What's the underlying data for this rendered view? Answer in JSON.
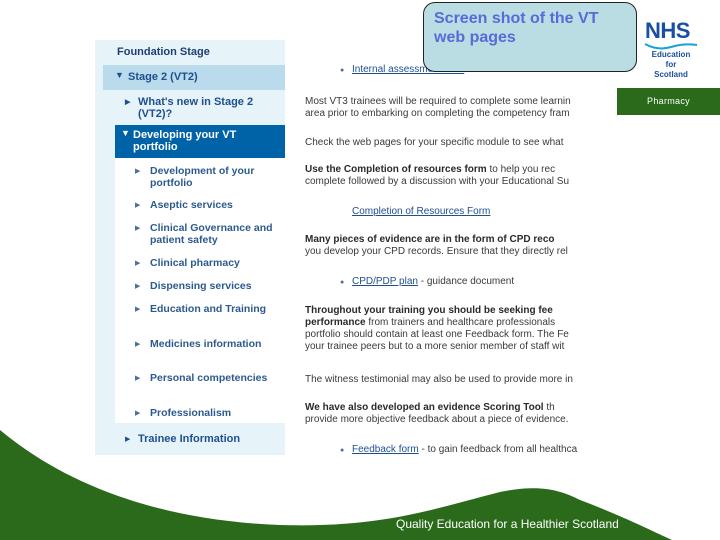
{
  "callout": {
    "text": "Screen shot of the VT web pages"
  },
  "logo": {
    "brand": "NHS",
    "subtitle_lines": [
      "Education",
      "for",
      "Scotland"
    ]
  },
  "section_badge": {
    "label": "Pharmacy"
  },
  "footer": {
    "tagline": "Quality Education for a Healthier Scotland"
  },
  "colors": {
    "brand_green": "#2a6a1a",
    "nav_active": "#0063a8",
    "nav_bg": "#e6f4fa",
    "nav_stage": "#b9dbec",
    "callout_bg": "#b9dde3",
    "callout_text": "#5a6ad9",
    "nhs_blue": "#1a4e9f"
  },
  "sidebar": {
    "top_item": "Foundation Stage",
    "stage": {
      "label": "Stage 2 (VT2)"
    },
    "whats_new": {
      "label": "What's new in Stage 2 (VT2)?"
    },
    "active": {
      "label": "Developing your VT portfolio"
    },
    "sub_items": [
      {
        "label": "Development of your portfolio"
      },
      {
        "label": "Aseptic services"
      },
      {
        "label": "Clinical Governance and patient safety"
      },
      {
        "label": "Clinical pharmacy"
      },
      {
        "label": "Dispensing services"
      },
      {
        "label": "Education and Training"
      },
      {
        "label": "Medicines information"
      },
      {
        "label": "Personal competencies"
      },
      {
        "label": "Professionalism"
      }
    ],
    "trainee": {
      "label": "Trainee Information"
    }
  },
  "main": {
    "top_link": "Internal assessment form",
    "para1_line1": "Most VT3 trainees will be required to complete some learnin",
    "para1_line2": "area prior to embarking on completing the competency fram",
    "para2": "Check the web pages for your specific module to see what",
    "para3_bold": "Use the Completion of resources form",
    "para3_rest": " to help you rec",
    "para3_line2": "complete followed by a discussion with your Educational Su",
    "link_resources": "Completion of Resources Form",
    "para4_line1": "Many pieces of evidence are in the form of CPD reco",
    "para4_line2": "you develop your CPD records. Ensure that they directly rel",
    "cpd_link": "CPD/PDP plan",
    "cpd_rest": " - guidance document",
    "para5_line1": "Throughout your training you should be seeking fee",
    "para5_line2_bold": "performance",
    "para5_line2_rest": " from trainers and healthcare professionals",
    "para5_line3": "portfolio should contain at least one Feedback form. The Fe",
    "para5_line4": "your trainee peers but to a more senior member of staff wit",
    "para6": "The witness testimonial may also be used to provide more in",
    "para7_bold": "We have also developed an evidence Scoring Tool",
    "para7_rest": " th",
    "para7_line2": "provide more objective feedback about a piece of evidence.",
    "feedback_link": "Feedback form",
    "feedback_rest": " - to gain feedback from all healthca"
  }
}
